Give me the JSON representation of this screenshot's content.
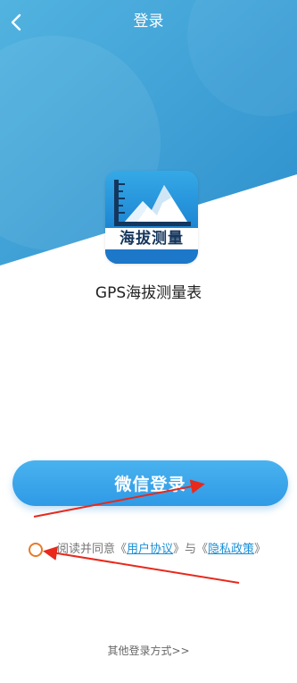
{
  "header": {
    "title": "登录",
    "back_icon": "chevron-left-icon"
  },
  "app": {
    "icon_label": "海拔测量",
    "icon_name": "mountain-ruler-icon",
    "name": "GPS海拔测量表"
  },
  "login": {
    "wechat_button_label": "微信登录",
    "agree_prefix": "阅读并同意《",
    "user_agreement_label": "用户协议",
    "agree_middle": "》与《",
    "privacy_policy_label": "隐私政策",
    "agree_suffix": "》",
    "other_methods_label": "其他登录方式>>"
  },
  "colors": {
    "background_blue": "#3c9fd6",
    "button_blue": "#3ba6ec",
    "link_blue": "#1a8fd6",
    "checkbox_orange": "#e87a2a",
    "annotation_red": "#e8291c"
  }
}
